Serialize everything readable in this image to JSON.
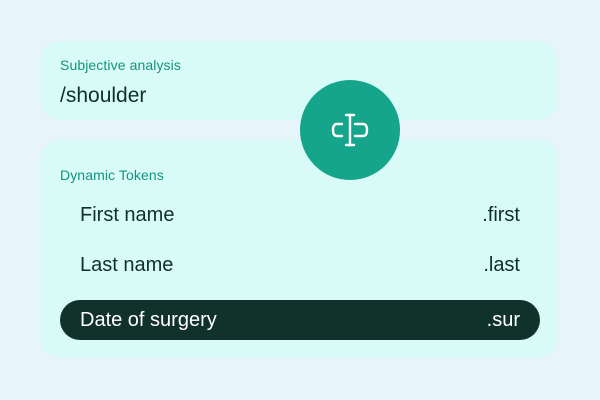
{
  "subjective": {
    "label": "Subjective analysis",
    "command": "/shoulder"
  },
  "tokens": {
    "label": "Dynamic Tokens",
    "items": [
      {
        "name": "First name",
        "code": ".first",
        "selected": false
      },
      {
        "name": "Last name",
        "code": ".last",
        "selected": false
      },
      {
        "name": "Date of surgery",
        "code": ".sur",
        "selected": true
      }
    ]
  },
  "icon": {
    "name": "text-cursor-input-icon",
    "background": "#14a58b"
  },
  "colors": {
    "page_background": "#e8f4fb",
    "card_background": "#d9fbf8",
    "accent_text": "#14937d",
    "selected_row": "#11312b"
  }
}
